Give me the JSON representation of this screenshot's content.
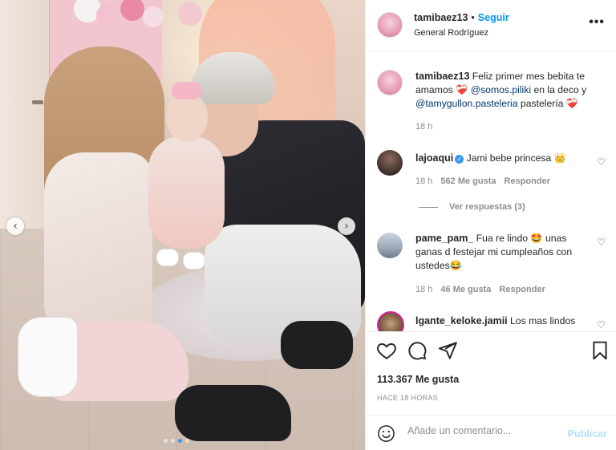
{
  "post": {
    "author": "tamibaez13",
    "follow_label": "Seguir",
    "location": "General Rodríguez",
    "more_label": "•••"
  },
  "carousel": {
    "prev_glyph": "‹",
    "next_glyph": "›",
    "slide_count": 4,
    "active_index": 2
  },
  "caption": {
    "username": "tamibaez13",
    "text_1": "Feliz primer mes bebita te amamos ",
    "emoji_1": "❤️‍🩹",
    "mention_1": "@somos.piliki",
    "text_2": " en la deco y ",
    "mention_2": "@tamygullon.pasteleria",
    "text_3": " pastelería ",
    "emoji_2": "❤️‍🩹",
    "time": "18 h"
  },
  "comments": [
    {
      "username": "lajoaqui",
      "verified_glyph": "✓",
      "text": "Jami bebe princesa ",
      "emoji": "👑",
      "time": "18 h",
      "likes": "562 Me gusta",
      "reply_label": "Responder"
    },
    {
      "username": "pame_pam_",
      "text": "Fua re lindo ",
      "emoji": "🤩",
      "text_2": " unas ganas d festejar mi cumpleaños con ustedes",
      "emoji_2": "😂",
      "time": "18 h",
      "likes": "46 Me gusta",
      "reply_label": "Responder"
    },
    {
      "username": "lgante_keloke.jamii",
      "text": "Los mas lindos"
    }
  ],
  "view_replies": "Ver respuestas (3)",
  "likes_total": "113.367 Me gusta",
  "posted_ago": "HACE 18 HORAS",
  "comment_box": {
    "placeholder": "Añade un comentario...",
    "publish_label": "Publicar"
  },
  "colors": {
    "link_blue": "#0095f6",
    "mention_blue": "#00376b",
    "muted_gray": "#8e8e8e",
    "publish_disabled": "#b2dffc",
    "active_dot": "#3897f0"
  }
}
